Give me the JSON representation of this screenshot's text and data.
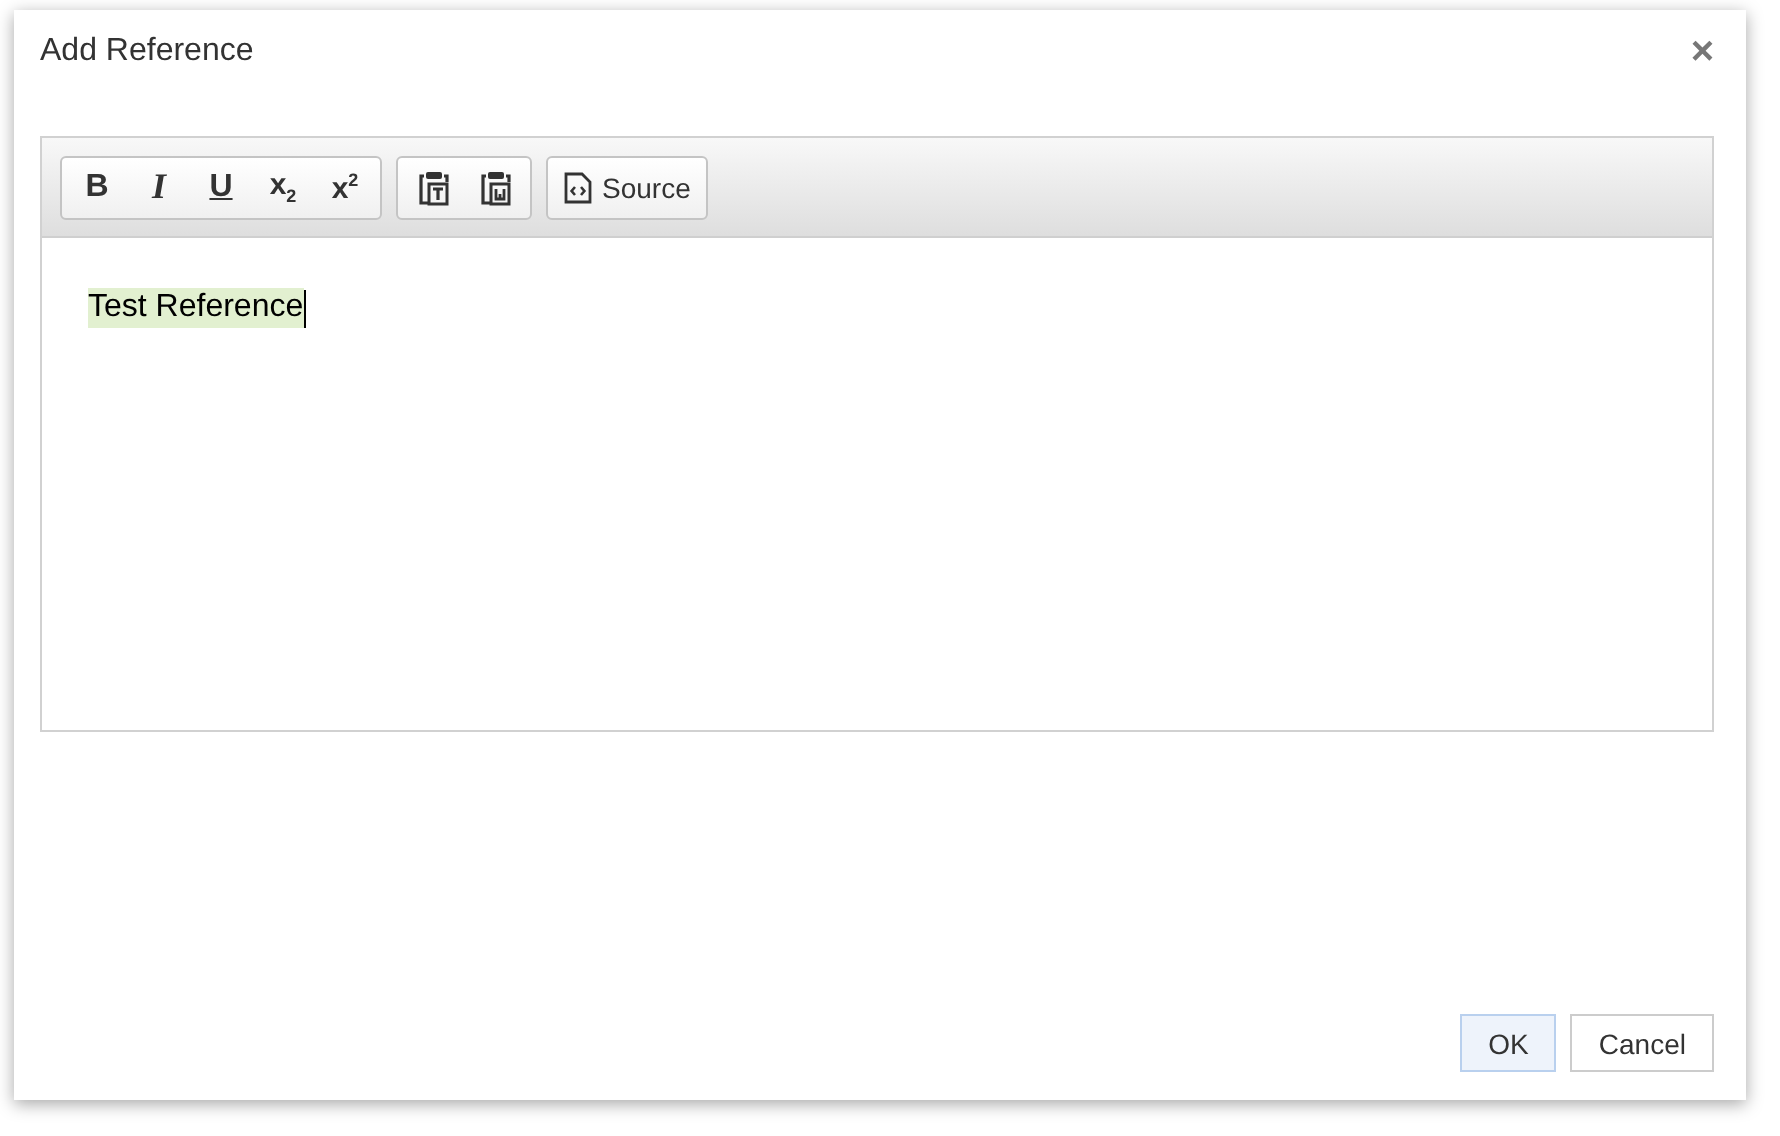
{
  "dialog": {
    "title": "Add Reference",
    "close": "×"
  },
  "toolbar": [
    {
      "buttons": [
        {
          "kind": "bold",
          "label": "B"
        },
        {
          "kind": "italic",
          "label": "I"
        },
        {
          "kind": "underline",
          "label": "U"
        },
        {
          "kind": "subscript",
          "label": "x",
          "mark": "2"
        },
        {
          "kind": "superscript",
          "label": "x",
          "mark": "2"
        }
      ]
    },
    {
      "buttons": [
        {
          "kind": "paste-text"
        },
        {
          "kind": "paste-word"
        }
      ]
    },
    {
      "buttons": [
        {
          "kind": "source",
          "label": "Source"
        }
      ]
    }
  ],
  "editor": {
    "text": "Test Reference",
    "highlighted": true
  },
  "buttons": [
    {
      "label": "OK",
      "default": true
    },
    {
      "label": "Cancel",
      "default": false
    }
  ]
}
